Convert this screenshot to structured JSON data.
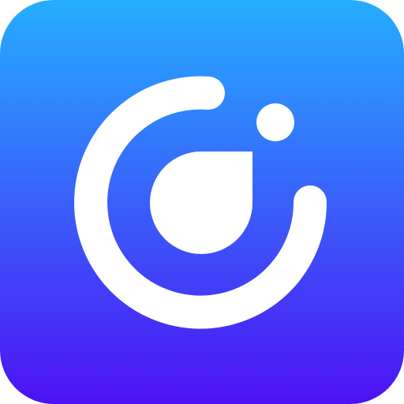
{
  "icon": {
    "name": "app-logo-icon",
    "background_gradient": {
      "top_color": "#25AEFF",
      "bottom_color": "#4D12F5"
    },
    "glyph_color": "#FFFFFF"
  }
}
